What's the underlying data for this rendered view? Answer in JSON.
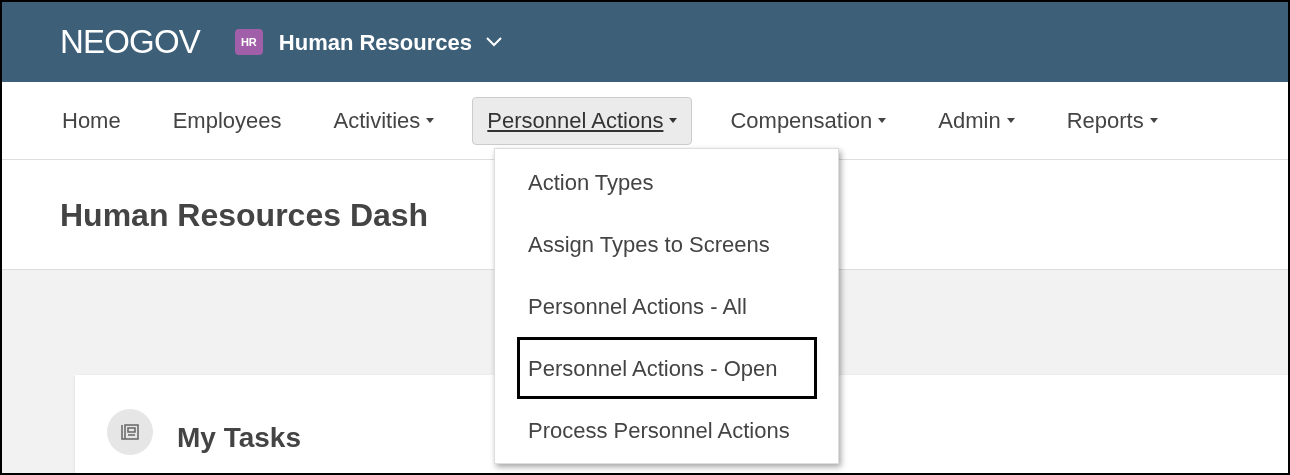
{
  "header": {
    "logo": "NEOGOV",
    "app_badge": "HR",
    "app_name": "Human Resources"
  },
  "nav": [
    {
      "label": "Home",
      "has_menu": false,
      "selected": false
    },
    {
      "label": "Employees",
      "has_menu": false,
      "selected": false
    },
    {
      "label": "Activities",
      "has_menu": true,
      "selected": false
    },
    {
      "label": "Personnel Actions",
      "has_menu": true,
      "selected": true
    },
    {
      "label": "Compensation",
      "has_menu": true,
      "selected": false
    },
    {
      "label": "Admin",
      "has_menu": true,
      "selected": false
    },
    {
      "label": "Reports",
      "has_menu": true,
      "selected": false
    }
  ],
  "dropdown": [
    {
      "label": "Action Types",
      "selected": false
    },
    {
      "label": "Assign Types to Screens",
      "selected": false
    },
    {
      "label": "Personnel Actions - All",
      "selected": false
    },
    {
      "label": "Personnel Actions - Open",
      "selected": true
    },
    {
      "label": "Process Personnel Actions",
      "selected": false
    }
  ],
  "page_title": "Human Resources Dash",
  "card": {
    "title": "My Tasks"
  }
}
